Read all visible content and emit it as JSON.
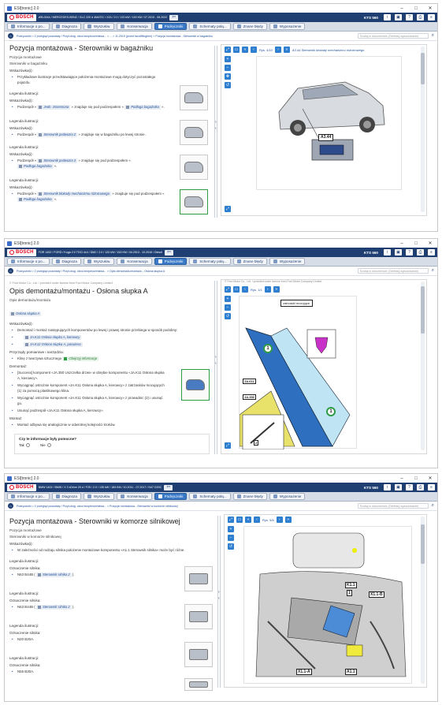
{
  "windows": [
    {
      "title": "ESI[tronic] 2.0",
      "vehicle": "WB-0044 / MERCEDES-BENZ / GLC 220 d 4MATIC / X15 / 2.0 / 120 kW / 163 KM / 07.2015 - 06.2022",
      "kts": "KTS 560",
      "tabs": [
        "Informacje o po...",
        "Diagnoza",
        "Wyszukiw.",
        "Konserwacja",
        "Podręczniki",
        "Schematy połą...",
        "Znane błędy",
        "Wyposażenie"
      ],
      "breadcrumb": "Podręczniki > 2 przegląd pozostały / Przył.drug. obcz.bezpieczeństwa... > ... > 11.2019 (przed faceliftingiem) > Pozycja montażowa - Sterowniki w bagażniku",
      "search_placeholder": "Szukaj w dokumencie (Zdefiniuj wyszukiwanie)",
      "page_title": "Pozycja montażowa - Sterowniki w bagażniku",
      "intro": [
        "Pozycja montażowe",
        "Sterowniki w bagażniku"
      ],
      "hints_label": "Wskazówka(i):",
      "hint": "Przykładowe ilustracje przedstawiające położenia montażowe mogą dotyczyć pozostałego pojazdu.",
      "legend_label": "Legenda ilustracji:",
      "hint2": "Wskazówka(i):",
      "items": [
        {
          "pre": "Podzespół «",
          "chip": "Jedn. zmiennona",
          "mid": "» znajduje się pod podzespołem «",
          "chip2": "Podłoga bagażnika",
          "post": "»."
        },
        {
          "pre": "Podzespół «",
          "chip": "Sterownik podwozia 2",
          "mid": "» znajduje się w bagażniku po lewej stronie.",
          "chip2": "",
          "post": ""
        },
        {
          "pre": "Podzespół «",
          "chip": "Sterownik podwozia 3",
          "mid": "» znajduje się pod podzespołem «",
          "chip2": "Podłoga bagażnika",
          "post": "»."
        },
        {
          "pre": "Podzespół «",
          "chip": "Sterownik blokady mechanizmu różnicowego",
          "mid": "» znajduje się pod podzespołem «",
          "chip2": "Podłoga bagażnika",
          "post": "»."
        }
      ],
      "img_count": "Rys. 4/10",
      "img_caption": "A3.44 Sterownik blokady mechanizmu różnicowego",
      "callout": "A3.44"
    },
    {
      "title": "ESI[tronic] 2.0",
      "vehicle": "FOR 1402 / FORD / Kuga 2.0 TDCi 4x4 / DM2 / 2.0 / 120 kW / 163 KM / 04.2013 - 10.2016 / Diesel",
      "kts": "KTS 560",
      "tabs": [
        "Informacje o po...",
        "Diagnoza",
        "Wyszukiw.",
        "Konserwacja",
        "Podręczniki",
        "Schematy połą...",
        "Znane błędy",
        "Wyposażenie"
      ],
      "breadcrumb": "Podręczniki > 2 przegląd pozostały / Przył.drug. obcz.bezpieczeństwa... > Opis demontażu/montażu - Osłona słupka A",
      "copyright": "© Ford Motor Co., Ltd. / provided under license from Ford Motor Company Limited",
      "page_title": "Opis demontażu/montażu - Osłona słupka A",
      "intro": "Opis demontażu/montażu",
      "intro_chip": "Osłona słupka A",
      "hints_label": "Wskazówka(i):",
      "bullets": [
        "Demontaż i montaż następujących komponentów po lewej i prawej stronie przebiega w sposób podobny:",
        "JA.K11 Osłona słupka A, kierowcy",
        "JA.K12 Osłona słupka A, pasażera"
      ],
      "tools_label": "Przyrządy pomiarowe i narzędzia:",
      "tool": "Klinę z tworzywa sztucznego",
      "tool_chip": "Obejrzyj informacje",
      "removal_label": "Demontaż:",
      "steps": [
        "[Success] komponent «JA.350 Uszczelka drzwi» w obrębie komponentu «JA.K11 Osłona słupka A, kierowcy».",
        "Wyciągnąć ostrożnie komponent «JA.K11 Osłona słupka A, kierowcy» z zatrzasków mocujących (1) za pomocą plastikowego klina.",
        "Wyciągnąć ostrożnie komponent «JA.K11 Osłona słupka A, kierowcy» z prowadnic (2) i usunąć go.",
        "Usunąć podzespół «JA.K11 Osłona słupka A, kierowcy»."
      ],
      "install_label": "Montaż:",
      "install": "Montaż odbywa się analogicznie w odwrotnej kolejności kroków.",
      "question": "Czy te informacje były pomocne?",
      "yes": "Tak",
      "no": "Nie",
      "img_count": "Rys. 1/1",
      "popup": "zatrzaski mocujące.",
      "labels": [
        "JA.611",
        "JA.350",
        "1",
        "2",
        "1"
      ]
    },
    {
      "title": "ESI[tronic] 2.0",
      "vehicle": "BMW 1402 / BMW / X 3 xDrive 20 d / F25 / 2.0 / 135 kW / 184 KM / 10.2011 - 07.2017 / N47 D20C",
      "kts": "KTS 560",
      "tabs": [
        "Informacje o po...",
        "Diagnoza",
        "Wyszukiw.",
        "Konserwacja",
        "Podręczniki",
        "Schematy połą...",
        "Znane błędy",
        "Wyposażenie"
      ],
      "breadcrumb": "Podręczniki > 2 przegląd pozostały / Przył.drug. obcz.bezpieczeństwa... > Pozycja montażowa - Sterowniki w komorze silnikowej",
      "page_title": "Pozycja montażowa - Sterowniki w komorze silnikowej",
      "intro": [
        "Pozycja montażowe",
        "Sterowniki w komorze silnikowej"
      ],
      "hints_label": "Wskazówka(i):",
      "hint": "W zależności od rodzaju silnika położenie montażowe komponentu «A1.1 Sterownik silnika» może być różne.",
      "hint_chip": "A1.1 Sterownik silnika",
      "legend_label": "Legenda ilustracji:",
      "engine_label": "Oznaczenie silnika:",
      "engines": [
        {
          "text": "N63 B44B (",
          "chip": "Sterownik silnika 2",
          "post": ")."
        },
        {
          "text": "N63 B44B (",
          "chip": "Sterownik silnika 2",
          "post": ")."
        },
        {
          "text": "N20 B20A.",
          "chip": "",
          "post": ""
        },
        {
          "text": "N55 B30A.",
          "chip": "",
          "post": ""
        }
      ],
      "img_count": "Rys. 5/6",
      "labels": [
        "K1.1",
        "1",
        "X1.1-B",
        "X1.1-A",
        "A1.1"
      ]
    }
  ],
  "icons": [
    "home-icon",
    "search-icon",
    "zoom-in-icon",
    "zoom-out-icon",
    "reset-icon",
    "expand-icon"
  ]
}
